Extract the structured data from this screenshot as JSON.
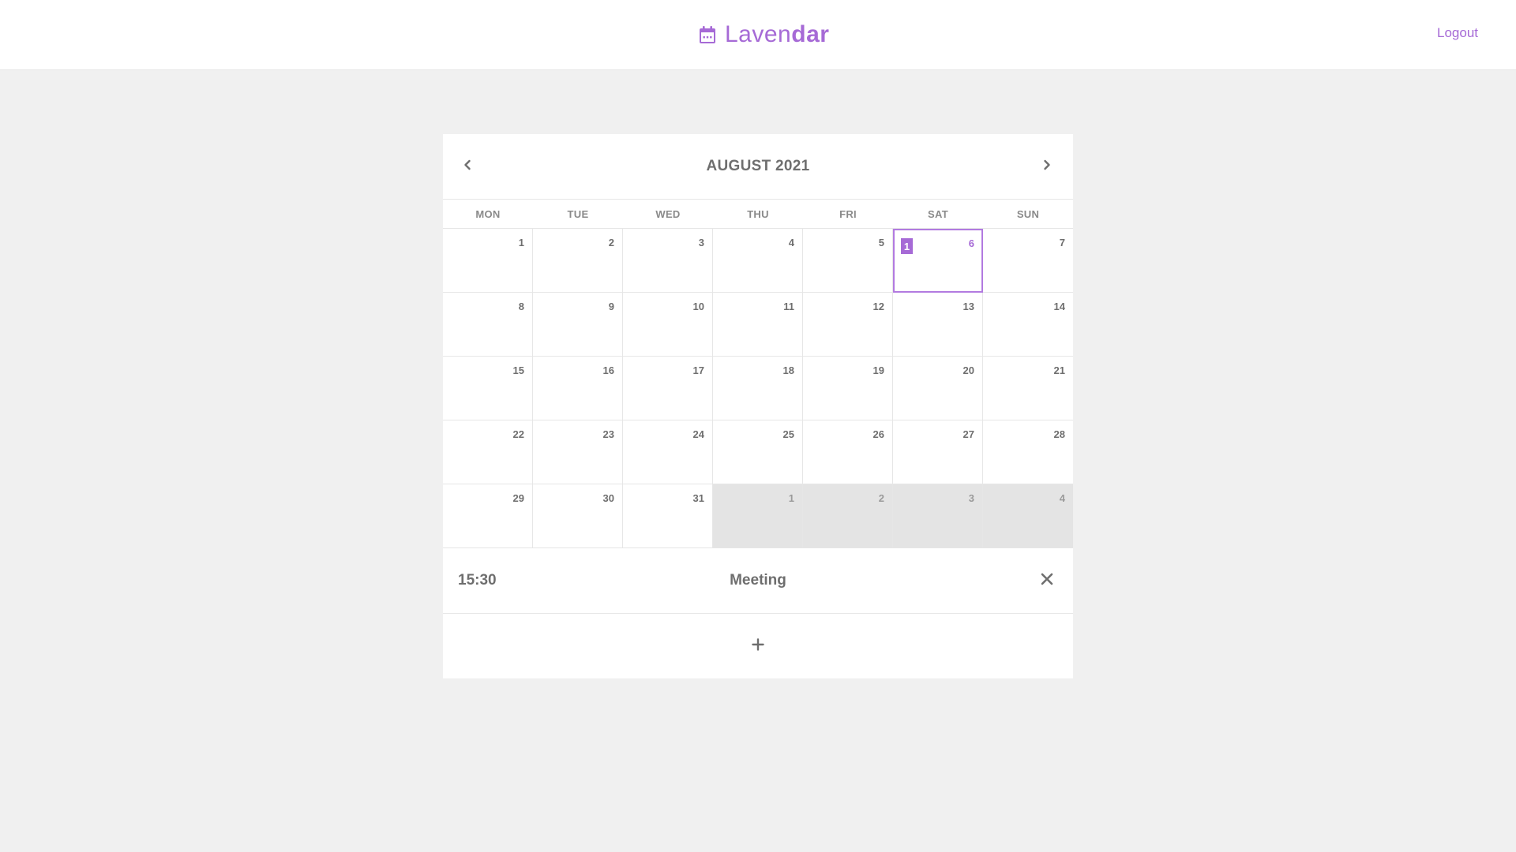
{
  "header": {
    "brand_light": "Laven",
    "brand_bold": "dar",
    "logout_label": "Logout",
    "icon": "calendar-icon"
  },
  "calendar": {
    "month_title": "AUGUST 2021",
    "prev_icon": "chevron-left-icon",
    "next_icon": "chevron-right-icon",
    "weekdays": [
      "MON",
      "TUE",
      "WED",
      "THU",
      "FRI",
      "SAT",
      "SUN"
    ],
    "days": [
      {
        "n": "1"
      },
      {
        "n": "2"
      },
      {
        "n": "3"
      },
      {
        "n": "4"
      },
      {
        "n": "5"
      },
      {
        "n": "6",
        "selected": true,
        "events": "1"
      },
      {
        "n": "7"
      },
      {
        "n": "8"
      },
      {
        "n": "9"
      },
      {
        "n": "10"
      },
      {
        "n": "11"
      },
      {
        "n": "12"
      },
      {
        "n": "13"
      },
      {
        "n": "14"
      },
      {
        "n": "15"
      },
      {
        "n": "16"
      },
      {
        "n": "17"
      },
      {
        "n": "18"
      },
      {
        "n": "19"
      },
      {
        "n": "20"
      },
      {
        "n": "21"
      },
      {
        "n": "22"
      },
      {
        "n": "23"
      },
      {
        "n": "24"
      },
      {
        "n": "25"
      },
      {
        "n": "26"
      },
      {
        "n": "27"
      },
      {
        "n": "28"
      },
      {
        "n": "29"
      },
      {
        "n": "30"
      },
      {
        "n": "31"
      },
      {
        "n": "1",
        "muted": true
      },
      {
        "n": "2",
        "muted": true
      },
      {
        "n": "3",
        "muted": true
      },
      {
        "n": "4",
        "muted": true
      }
    ]
  },
  "event": {
    "time": "15:30",
    "title": "Meeting",
    "close_icon": "close-icon"
  },
  "add": {
    "icon": "plus-icon"
  },
  "colors": {
    "accent": "#a66ad6",
    "muted_cell": "#e4e4e4",
    "background": "#f0f0f0"
  }
}
